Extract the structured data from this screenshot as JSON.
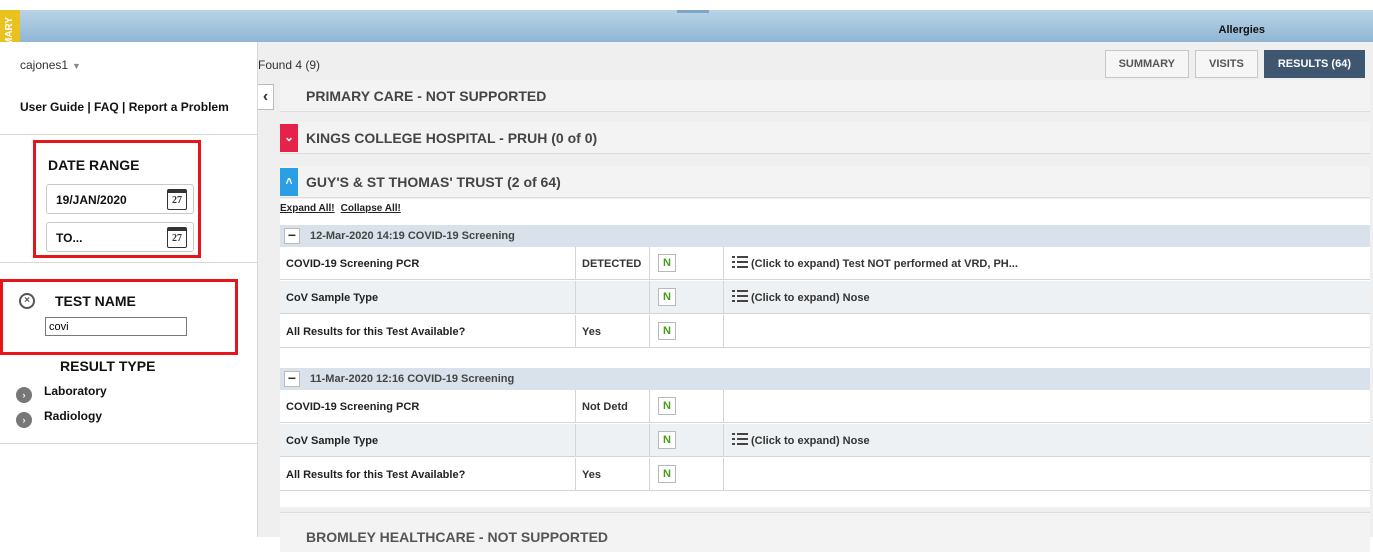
{
  "topbar": {
    "side_tab": "MARY",
    "allergies": "Allergies"
  },
  "sidebar": {
    "user": "cajones1",
    "links": "User Guide | FAQ | Report a Problem",
    "date_range": {
      "title": "DATE RANGE",
      "from": "19/JAN/2020",
      "to_placeholder": "TO...",
      "cal_day": "27"
    },
    "test_name": {
      "title": "TEST NAME",
      "value": "covi"
    },
    "result_type": {
      "title": "RESULT TYPE",
      "items": [
        "Laboratory",
        "Radiology"
      ]
    }
  },
  "main": {
    "found": "Found 4 (9)",
    "tabs": [
      {
        "label": "SUMMARY"
      },
      {
        "label": "VISITS"
      },
      {
        "label": "RESULTS (64)"
      }
    ],
    "providers": {
      "primary": "PRIMARY CARE - NOT SUPPORTED",
      "kings": "KINGS COLLEGE HOSPITAL - PRUH  (0 of 0)",
      "guys": "GUY'S & ST THOMAS' TRUST  (2 of 64)",
      "bromley": "BROMLEY HEALTHCARE - NOT SUPPORTED"
    },
    "expand_all": "Expand All!",
    "collapse_all": "Collapse All!",
    "groups": [
      {
        "header": "12-Mar-2020 14:19    COVID-19 Screening",
        "rows": [
          {
            "test": "COVID-19 Screening PCR",
            "result": "DETECTED",
            "flag": "N",
            "note": "(Click to expand) Test NOT performed at VRD, PH..."
          },
          {
            "test": "CoV Sample Type",
            "result": "",
            "flag": "N",
            "note": "(Click to expand) Nose"
          },
          {
            "test": "All Results for this Test Available?",
            "result": "Yes",
            "flag": "N",
            "note": ""
          }
        ]
      },
      {
        "header": "11-Mar-2020 12:16    COVID-19 Screening",
        "rows": [
          {
            "test": "COVID-19 Screening PCR",
            "result": "Not Detd",
            "flag": "N",
            "note": ""
          },
          {
            "test": "CoV Sample Type",
            "result": "",
            "flag": "N",
            "note": "(Click to expand) Nose"
          },
          {
            "test": "All Results for this Test Available?",
            "result": "Yes",
            "flag": "N",
            "note": ""
          }
        ]
      }
    ]
  }
}
